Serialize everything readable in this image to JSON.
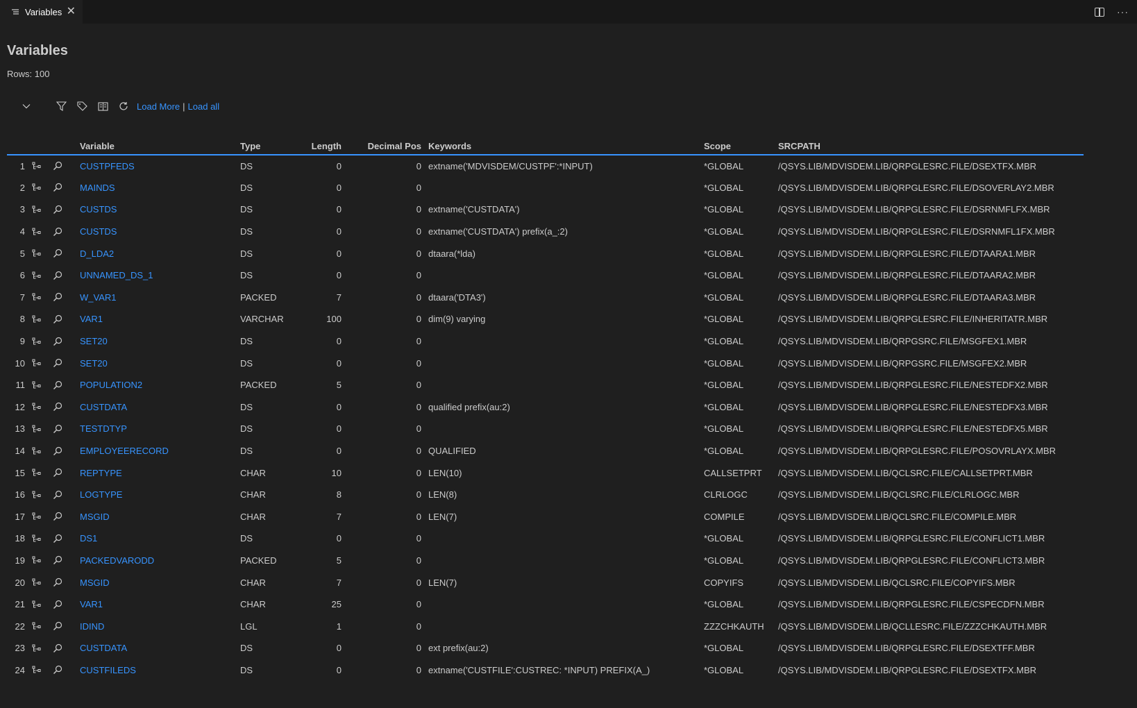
{
  "tab": {
    "title": "Variables",
    "close": "✕"
  },
  "title": "Variables",
  "rows_label": "Rows: 100",
  "toolbar": {
    "load_more": "Load More",
    "separator": "|",
    "load_all": "Load all"
  },
  "columns": [
    "",
    "",
    "",
    "Variable",
    "Type",
    "Length",
    "Decimal Pos",
    "Keywords",
    "Scope",
    "SRCPATH"
  ],
  "rows": [
    {
      "n": "1",
      "variable": "CUSTPFEDS",
      "type": "DS",
      "length": "0",
      "decimal": "0",
      "keywords": "extname('MDVISDEM/CUSTPF':*INPUT)",
      "scope": "*GLOBAL",
      "srcpath": "/QSYS.LIB/MDVISDEM.LIB/QRPGLESRC.FILE/DSEXTFX.MBR"
    },
    {
      "n": "2",
      "variable": "MAINDS",
      "type": "DS",
      "length": "0",
      "decimal": "0",
      "keywords": "",
      "scope": "*GLOBAL",
      "srcpath": "/QSYS.LIB/MDVISDEM.LIB/QRPGLESRC.FILE/DSOVERLAY2.MBR"
    },
    {
      "n": "3",
      "variable": "CUSTDS",
      "type": "DS",
      "length": "0",
      "decimal": "0",
      "keywords": "extname('CUSTDATA')",
      "scope": "*GLOBAL",
      "srcpath": "/QSYS.LIB/MDVISDEM.LIB/QRPGLESRC.FILE/DSRNMFLFX.MBR"
    },
    {
      "n": "4",
      "variable": "CUSTDS",
      "type": "DS",
      "length": "0",
      "decimal": "0",
      "keywords": "extname('CUSTDATA') prefix(a_:2)",
      "scope": "*GLOBAL",
      "srcpath": "/QSYS.LIB/MDVISDEM.LIB/QRPGLESRC.FILE/DSRNMFL1FX.MBR"
    },
    {
      "n": "5",
      "variable": "D_LDA2",
      "type": "DS",
      "length": "0",
      "decimal": "0",
      "keywords": "dtaara(*lda)",
      "scope": "*GLOBAL",
      "srcpath": "/QSYS.LIB/MDVISDEM.LIB/QRPGLESRC.FILE/DTAARA1.MBR"
    },
    {
      "n": "6",
      "variable": "UNNAMED_DS_1",
      "type": "DS",
      "length": "0",
      "decimal": "0",
      "keywords": "",
      "scope": "*GLOBAL",
      "srcpath": "/QSYS.LIB/MDVISDEM.LIB/QRPGLESRC.FILE/DTAARA2.MBR"
    },
    {
      "n": "7",
      "variable": "W_VAR1",
      "type": "PACKED",
      "length": "7",
      "decimal": "0",
      "keywords": "dtaara('DTA3')",
      "scope": "*GLOBAL",
      "srcpath": "/QSYS.LIB/MDVISDEM.LIB/QRPGLESRC.FILE/DTAARA3.MBR"
    },
    {
      "n": "8",
      "variable": "VAR1",
      "type": "VARCHAR",
      "length": "100",
      "decimal": "0",
      "keywords": "dim(9) varying",
      "scope": "*GLOBAL",
      "srcpath": "/QSYS.LIB/MDVISDEM.LIB/QRPGLESRC.FILE/INHERITATR.MBR"
    },
    {
      "n": "9",
      "variable": "SET20",
      "type": "DS",
      "length": "0",
      "decimal": "0",
      "keywords": "",
      "scope": "*GLOBAL",
      "srcpath": "/QSYS.LIB/MDVISDEM.LIB/QRPGSRC.FILE/MSGFEX1.MBR"
    },
    {
      "n": "10",
      "variable": "SET20",
      "type": "DS",
      "length": "0",
      "decimal": "0",
      "keywords": "",
      "scope": "*GLOBAL",
      "srcpath": "/QSYS.LIB/MDVISDEM.LIB/QRPGSRC.FILE/MSGFEX2.MBR"
    },
    {
      "n": "11",
      "variable": "POPULATION2",
      "type": "PACKED",
      "length": "5",
      "decimal": "0",
      "keywords": "",
      "scope": "*GLOBAL",
      "srcpath": "/QSYS.LIB/MDVISDEM.LIB/QRPGLESRC.FILE/NESTEDFX2.MBR"
    },
    {
      "n": "12",
      "variable": "CUSTDATA",
      "type": "DS",
      "length": "0",
      "decimal": "0",
      "keywords": "qualified prefix(au:2)",
      "scope": "*GLOBAL",
      "srcpath": "/QSYS.LIB/MDVISDEM.LIB/QRPGLESRC.FILE/NESTEDFX3.MBR"
    },
    {
      "n": "13",
      "variable": "TESTDTYP",
      "type": "DS",
      "length": "0",
      "decimal": "0",
      "keywords": "",
      "scope": "*GLOBAL",
      "srcpath": "/QSYS.LIB/MDVISDEM.LIB/QRPGLESRC.FILE/NESTEDFX5.MBR"
    },
    {
      "n": "14",
      "variable": "EMPLOYEERECORD",
      "type": "DS",
      "length": "0",
      "decimal": "0",
      "keywords": "QUALIFIED",
      "scope": "*GLOBAL",
      "srcpath": "/QSYS.LIB/MDVISDEM.LIB/QRPGLESRC.FILE/POSOVRLAYX.MBR"
    },
    {
      "n": "15",
      "variable": "REPTYPE",
      "type": "CHAR",
      "length": "10",
      "decimal": "0",
      "keywords": "LEN(10)",
      "scope": "CALLSETPRT",
      "srcpath": "/QSYS.LIB/MDVISDEM.LIB/QCLSRC.FILE/CALLSETPRT.MBR"
    },
    {
      "n": "16",
      "variable": "LOGTYPE",
      "type": "CHAR",
      "length": "8",
      "decimal": "0",
      "keywords": "LEN(8)",
      "scope": "CLRLOGC",
      "srcpath": "/QSYS.LIB/MDVISDEM.LIB/QCLSRC.FILE/CLRLOGC.MBR"
    },
    {
      "n": "17",
      "variable": "MSGID",
      "type": "CHAR",
      "length": "7",
      "decimal": "0",
      "keywords": "LEN(7)",
      "scope": "COMPILE",
      "srcpath": "/QSYS.LIB/MDVISDEM.LIB/QCLSRC.FILE/COMPILE.MBR"
    },
    {
      "n": "18",
      "variable": "DS1",
      "type": "DS",
      "length": "0",
      "decimal": "0",
      "keywords": "",
      "scope": "*GLOBAL",
      "srcpath": "/QSYS.LIB/MDVISDEM.LIB/QRPGLESRC.FILE/CONFLICT1.MBR"
    },
    {
      "n": "19",
      "variable": "PACKEDVARODD",
      "type": "PACKED",
      "length": "5",
      "decimal": "0",
      "keywords": "",
      "scope": "*GLOBAL",
      "srcpath": "/QSYS.LIB/MDVISDEM.LIB/QRPGLESRC.FILE/CONFLICT3.MBR"
    },
    {
      "n": "20",
      "variable": "MSGID",
      "type": "CHAR",
      "length": "7",
      "decimal": "0",
      "keywords": "LEN(7)",
      "scope": "COPYIFS",
      "srcpath": "/QSYS.LIB/MDVISDEM.LIB/QCLSRC.FILE/COPYIFS.MBR"
    },
    {
      "n": "21",
      "variable": "VAR1",
      "type": "CHAR",
      "length": "25",
      "decimal": "0",
      "keywords": "",
      "scope": "*GLOBAL",
      "srcpath": "/QSYS.LIB/MDVISDEM.LIB/QRPGLESRC.FILE/CSPECDFN.MBR"
    },
    {
      "n": "22",
      "variable": "IDIND",
      "type": "LGL",
      "length": "1",
      "decimal": "0",
      "keywords": "",
      "scope": "ZZZCHKAUTH",
      "srcpath": "/QSYS.LIB/MDVISDEM.LIB/QCLLESRC.FILE/ZZZCHKAUTH.MBR"
    },
    {
      "n": "23",
      "variable": "CUSTDATA",
      "type": "DS",
      "length": "0",
      "decimal": "0",
      "keywords": "ext prefix(au:2)",
      "scope": "*GLOBAL",
      "srcpath": "/QSYS.LIB/MDVISDEM.LIB/QRPGLESRC.FILE/DSEXTFF.MBR"
    },
    {
      "n": "24",
      "variable": "CUSTFILEDS",
      "type": "DS",
      "length": "0",
      "decimal": "0",
      "keywords": "extname('CUSTFILE':CUSTREC: *INPUT) PREFIX(A_)",
      "scope": "*GLOBAL",
      "srcpath": "/QSYS.LIB/MDVISDEM.LIB/QRPGLESRC.FILE/DSEXTFX.MBR"
    }
  ]
}
